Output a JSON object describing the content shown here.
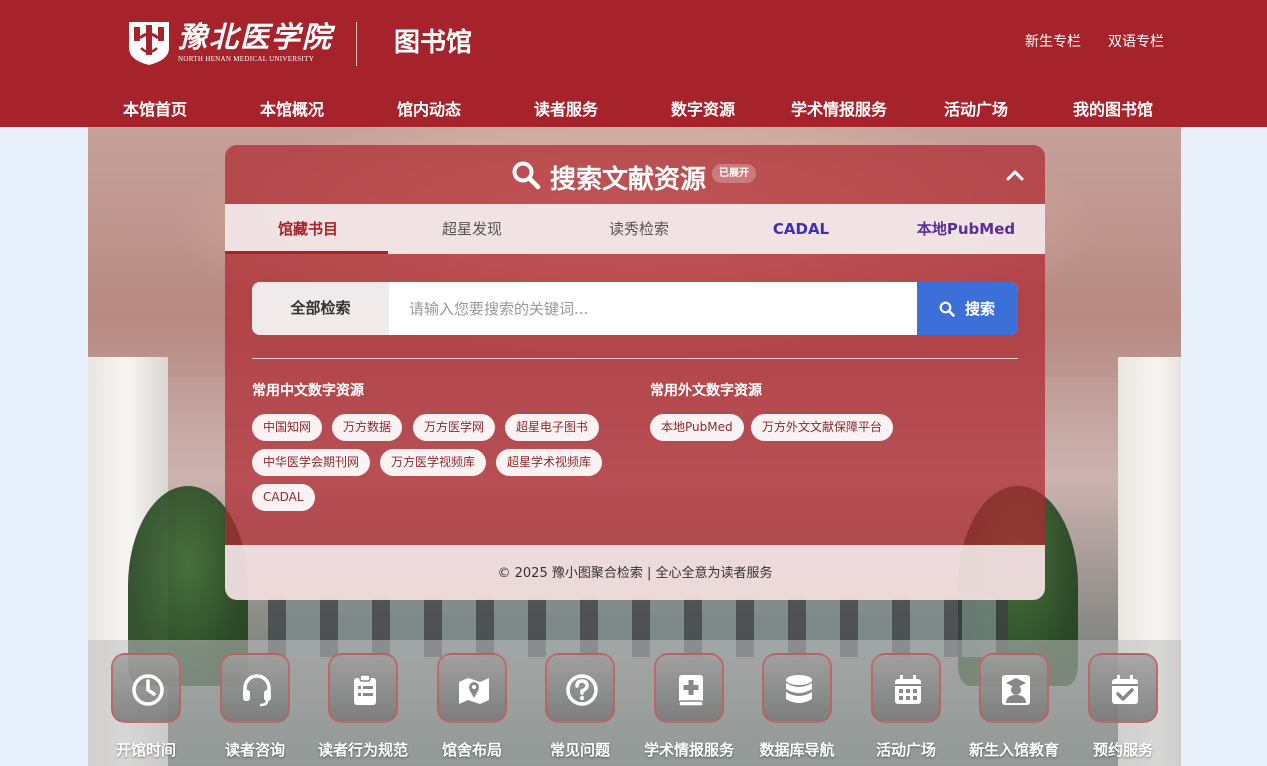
{
  "header": {
    "school_name": "豫北医学院",
    "school_name_en": "NORTH HENAN MEDICAL UNIVERSITY",
    "site_title": "图书馆",
    "top_links": [
      "新生专栏",
      "双语专栏"
    ],
    "nav": [
      "本馆首页",
      "本馆概况",
      "馆内动态",
      "读者服务",
      "数字资源",
      "学术情报服务",
      "活动广场",
      "我的图书馆"
    ]
  },
  "search_panel": {
    "title": "搜索文献资源",
    "badge": "已展开",
    "tabs": [
      "馆藏书目",
      "超星发现",
      "读秀检索",
      "CADAL",
      "本地PubMed"
    ],
    "active_tab": "馆藏书目",
    "scope": "全部检索",
    "placeholder": "请输入您要搜索的关键词...",
    "search_button": "搜索",
    "chinese_title": "常用中文数字资源",
    "chinese_resources": [
      "中国知网",
      "万方数据",
      "万方医学网",
      "超星电子图书",
      "中华医学会期刊网",
      "万方医学视频库",
      "超星学术视频库",
      "CADAL"
    ],
    "foreign_title": "常用外文数字资源",
    "foreign_resources": [
      "本地PubMed",
      "万方外文文献保障平台"
    ],
    "footer": "© 2025 豫小图聚合检索 | 全心全意为读者服务"
  },
  "quick_services": [
    {
      "label": "开馆时间",
      "icon": "clock-icon"
    },
    {
      "label": "读者咨询",
      "icon": "headset-icon"
    },
    {
      "label": "读者行为规范",
      "icon": "clipboard-list-icon"
    },
    {
      "label": "馆舍布局",
      "icon": "map-icon"
    },
    {
      "label": "常见问题",
      "icon": "question-icon"
    },
    {
      "label": "学术情报服务",
      "icon": "book-medical-icon"
    },
    {
      "label": "数据库导航",
      "icon": "database-icon"
    },
    {
      "label": "活动广场",
      "icon": "calendar-icon"
    },
    {
      "label": "新生入馆教育",
      "icon": "graduate-icon"
    },
    {
      "label": "预约服务",
      "icon": "calendar-check-icon"
    }
  ],
  "colors": {
    "brand": "#a6232b",
    "search_button": "#3c6fd8",
    "tab_blue": "#3b2fb8"
  }
}
